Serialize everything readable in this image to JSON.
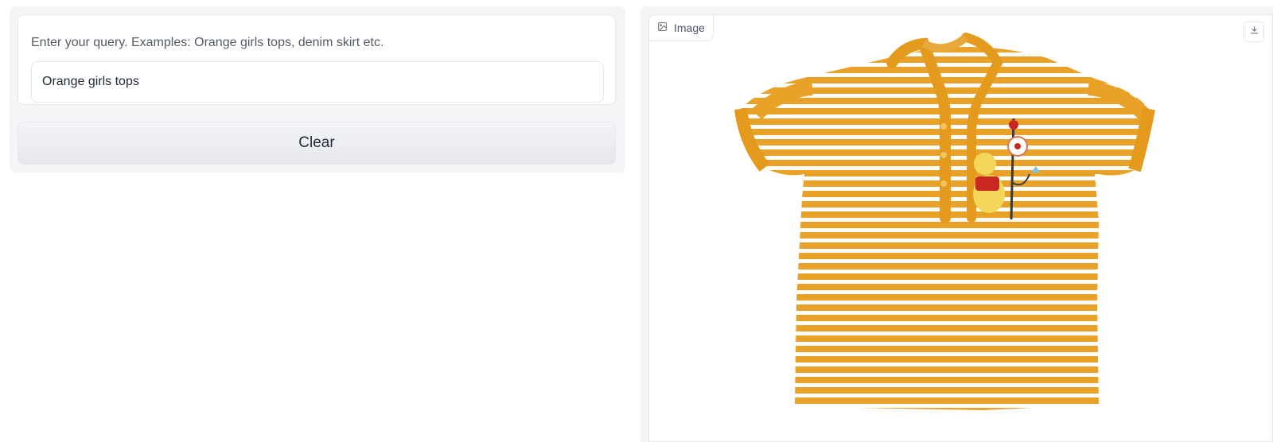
{
  "query": {
    "label": "Enter your query. Examples: Orange girls tops, denim skirt etc.",
    "value": "Orange girls tops"
  },
  "clear_button": {
    "label": "Clear"
  },
  "image_panel": {
    "tag_label": "Image",
    "tag_icon": "image-icon",
    "download_icon": "download-icon",
    "shirt_color": "#e9a227",
    "stripe_color": "#ffffff"
  }
}
